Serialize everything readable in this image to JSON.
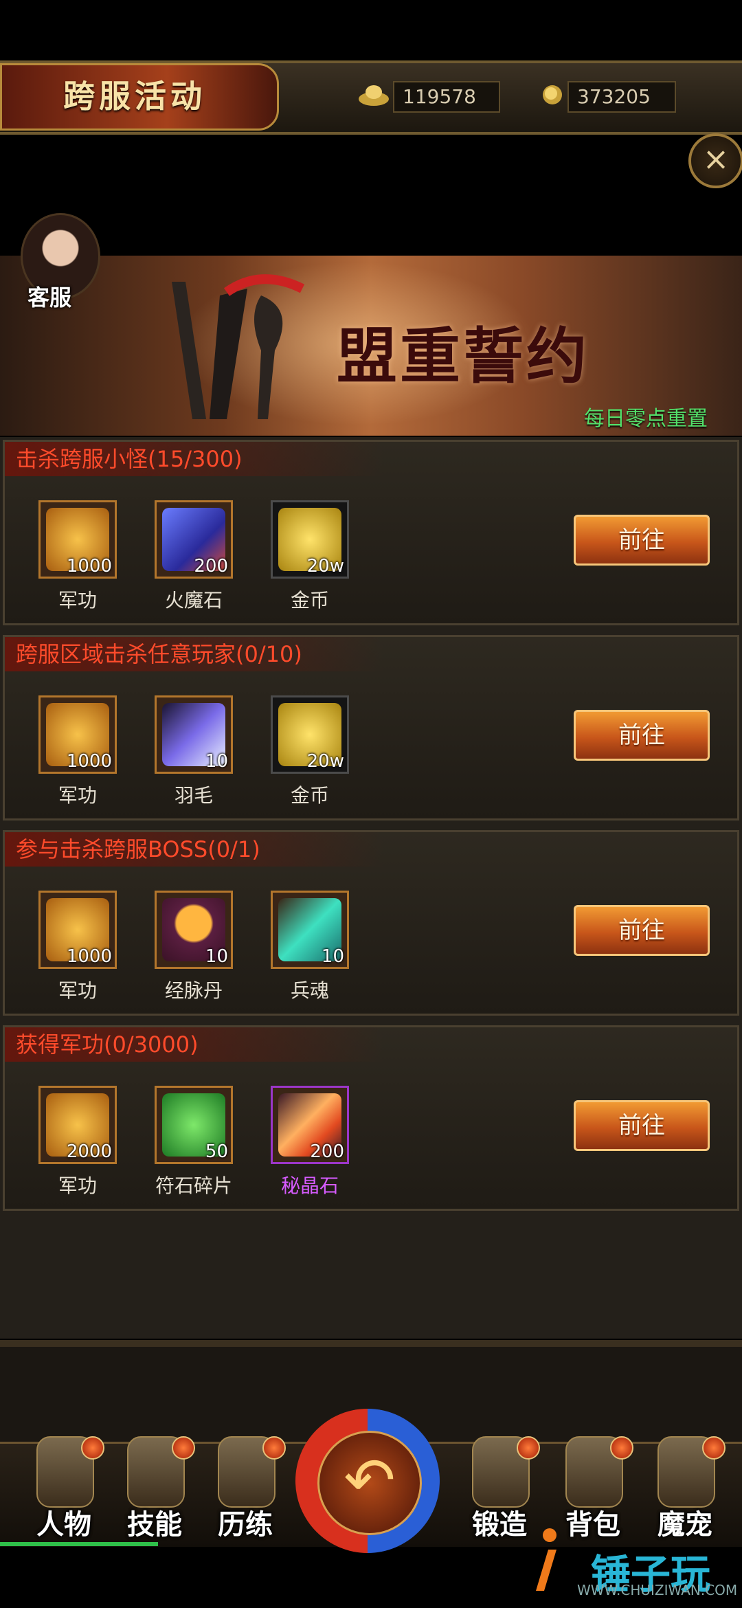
{
  "header": {
    "title": "跨服活动",
    "ingot_value": "119578",
    "coin_value": "373205"
  },
  "banner": {
    "title": "盟重誓约",
    "reset_text": "每日零点重置",
    "cs_label": "客服"
  },
  "tasks": [
    {
      "title": "击杀跨服小怪(15/300)",
      "button": "前往",
      "rewards": [
        {
          "name": "军功",
          "qty": "1000"
        },
        {
          "name": "火魔石",
          "qty": "200"
        },
        {
          "name": "金币",
          "qty": "20w"
        }
      ]
    },
    {
      "title": "跨服区域击杀任意玩家(0/10)",
      "button": "前往",
      "rewards": [
        {
          "name": "军功",
          "qty": "1000"
        },
        {
          "name": "羽毛",
          "qty": "10"
        },
        {
          "name": "金币",
          "qty": "20w"
        }
      ]
    },
    {
      "title": "参与击杀跨服BOSS(0/1)",
      "button": "前往",
      "rewards": [
        {
          "name": "军功",
          "qty": "1000"
        },
        {
          "name": "经脉丹",
          "qty": "10"
        },
        {
          "name": "兵魂",
          "qty": "10"
        }
      ]
    },
    {
      "title": "获得军功(0/3000)",
      "button": "前往",
      "rewards": [
        {
          "name": "军功",
          "qty": "2000"
        },
        {
          "name": "符石碎片",
          "qty": "50"
        },
        {
          "name": "秘晶石",
          "qty": "200"
        }
      ]
    }
  ],
  "dock": {
    "items": [
      "人物",
      "技能",
      "历练",
      "锻造",
      "背包",
      "魔宠"
    ]
  },
  "watermark": {
    "text": "锤子玩",
    "url": "WWW.CHUIZIWAN.COM"
  }
}
